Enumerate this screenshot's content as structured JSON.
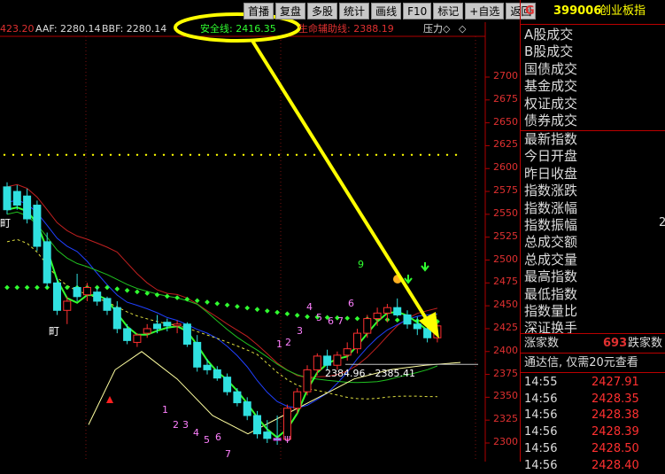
{
  "toolbar": {
    "buttons": [
      "首播",
      "复盘",
      "多股",
      "统计",
      "画线",
      "F10",
      "标记",
      "+自选",
      "返回"
    ]
  },
  "indicator_bar": {
    "ma_prefix": "423.20",
    "aaf": "AAF: 2280.14",
    "bbf": "BBF: 2280.14",
    "safety_line": "安全线: 2416.35",
    "lifeline": "生命辅助线: 2388.19",
    "pressure": "压力◇",
    "diamond": "◇"
  },
  "price_axis": {
    "labels": [
      "2700",
      "2675",
      "2650",
      "2625",
      "2600",
      "2575",
      "2550",
      "2525",
      "2500",
      "2475",
      "2450",
      "2425",
      "2400",
      "2375",
      "2350",
      "2325",
      "2300"
    ]
  },
  "chart_annotations": {
    "range_label": "2384.96 - 2385.41",
    "digit_labels": [
      "9",
      "6",
      "4",
      "5",
      "6",
      "7",
      "1",
      "2",
      "3",
      "1",
      "2",
      "3",
      "4",
      "5",
      "6",
      "7",
      "ψ"
    ],
    "ding1": "町",
    "ding2": "町"
  },
  "right_panel": {
    "code_letter": "G",
    "code": "399006",
    "name": "创业板指",
    "labels_group1": [
      "A股成交",
      "B股成交",
      "国债成交",
      "基金成交",
      "权证成交",
      "债券成交"
    ],
    "labels_group2": [
      "最新指数",
      "今日开盘",
      "昨日收盘",
      "指数涨跌",
      "指数涨幅",
      "指数振幅",
      "总成交额",
      "总成交量",
      "最高指数",
      "最低指数",
      "指数量比",
      "深证换手"
    ],
    "amplitude_value": "2",
    "up_label": "涨家数",
    "up_count": "693",
    "down_label": "跌家数",
    "promo": "通达信, 仅需20元查看",
    "ticks": [
      {
        "time": "14:55",
        "price": "2427.91"
      },
      {
        "time": "14:56",
        "price": "2428.35"
      },
      {
        "time": "14:56",
        "price": "2428.38"
      },
      {
        "time": "14:56",
        "price": "2428.39"
      },
      {
        "time": "14:56",
        "price": "2428.50"
      },
      {
        "time": "14:56",
        "price": "2428.40"
      }
    ]
  },
  "colors": {
    "up": "#ff3030",
    "down": "#30e0e0",
    "safety_green": "#30ff30",
    "highlight_yellow": "#ffff00",
    "panel_red": "#b00000",
    "magenta": "#ff30ff"
  },
  "chart_data": {
    "type": "candlestick",
    "title": "",
    "ylim": [
      2300,
      2700
    ],
    "y_ticks": [
      2300,
      2325,
      2350,
      2375,
      2400,
      2425,
      2450,
      2475,
      2500,
      2525,
      2550,
      2575,
      2600,
      2625,
      2650,
      2675,
      2700
    ],
    "candles": [
      {
        "o": 2580,
        "h": 2585,
        "l": 2550,
        "c": 2555
      },
      {
        "o": 2575,
        "h": 2582,
        "l": 2555,
        "c": 2560
      },
      {
        "o": 2570,
        "h": 2578,
        "l": 2540,
        "c": 2545
      },
      {
        "o": 2560,
        "h": 2565,
        "l": 2510,
        "c": 2515
      },
      {
        "o": 2520,
        "h": 2530,
        "l": 2470,
        "c": 2475
      },
      {
        "o": 2475,
        "h": 2480,
        "l": 2440,
        "c": 2445
      },
      {
        "o": 2445,
        "h": 2460,
        "l": 2430,
        "c": 2455
      },
      {
        "o": 2470,
        "h": 2485,
        "l": 2455,
        "c": 2460
      },
      {
        "o": 2462,
        "h": 2475,
        "l": 2455,
        "c": 2470
      },
      {
        "o": 2465,
        "h": 2470,
        "l": 2450,
        "c": 2455
      },
      {
        "o": 2458,
        "h": 2460,
        "l": 2440,
        "c": 2445
      },
      {
        "o": 2448,
        "h": 2455,
        "l": 2420,
        "c": 2425
      },
      {
        "o": 2425,
        "h": 2430,
        "l": 2408,
        "c": 2412
      },
      {
        "o": 2410,
        "h": 2420,
        "l": 2405,
        "c": 2418
      },
      {
        "o": 2420,
        "h": 2430,
        "l": 2415,
        "c": 2425
      },
      {
        "o": 2430,
        "h": 2440,
        "l": 2420,
        "c": 2425
      },
      {
        "o": 2432,
        "h": 2436,
        "l": 2422,
        "c": 2428
      },
      {
        "o": 2428,
        "h": 2434,
        "l": 2420,
        "c": 2430
      },
      {
        "o": 2430,
        "h": 2432,
        "l": 2405,
        "c": 2408
      },
      {
        "o": 2410,
        "h": 2418,
        "l": 2378,
        "c": 2383
      },
      {
        "o": 2385,
        "h": 2392,
        "l": 2375,
        "c": 2380
      },
      {
        "o": 2380,
        "h": 2384,
        "l": 2368,
        "c": 2371
      },
      {
        "o": 2372,
        "h": 2376,
        "l": 2352,
        "c": 2356
      },
      {
        "o": 2356,
        "h": 2360,
        "l": 2340,
        "c": 2344
      },
      {
        "o": 2345,
        "h": 2350,
        "l": 2325,
        "c": 2330
      },
      {
        "o": 2330,
        "h": 2335,
        "l": 2305,
        "c": 2310
      },
      {
        "o": 2312,
        "h": 2325,
        "l": 2300,
        "c": 2305
      },
      {
        "o": 2305,
        "h": 2330,
        "l": 2298,
        "c": 2303
      },
      {
        "o": 2304,
        "h": 2342,
        "l": 2302,
        "c": 2338
      },
      {
        "o": 2338,
        "h": 2360,
        "l": 2332,
        "c": 2356
      },
      {
        "o": 2356,
        "h": 2385,
        "l": 2352,
        "c": 2380
      },
      {
        "o": 2380,
        "h": 2398,
        "l": 2374,
        "c": 2395
      },
      {
        "o": 2395,
        "h": 2402,
        "l": 2380,
        "c": 2385
      },
      {
        "o": 2385,
        "h": 2400,
        "l": 2380,
        "c": 2396
      },
      {
        "o": 2396,
        "h": 2410,
        "l": 2390,
        "c": 2403
      },
      {
        "o": 2403,
        "h": 2425,
        "l": 2398,
        "c": 2420
      },
      {
        "o": 2420,
        "h": 2440,
        "l": 2415,
        "c": 2436
      },
      {
        "o": 2436,
        "h": 2448,
        "l": 2428,
        "c": 2442
      },
      {
        "o": 2442,
        "h": 2452,
        "l": 2432,
        "c": 2448
      },
      {
        "o": 2448,
        "h": 2458,
        "l": 2438,
        "c": 2440
      },
      {
        "o": 2440,
        "h": 2445,
        "l": 2425,
        "c": 2430
      },
      {
        "o": 2430,
        "h": 2438,
        "l": 2418,
        "c": 2425
      },
      {
        "o": 2425,
        "h": 2432,
        "l": 2410,
        "c": 2415
      },
      {
        "o": 2415,
        "h": 2430,
        "l": 2410,
        "c": 2428
      }
    ]
  }
}
